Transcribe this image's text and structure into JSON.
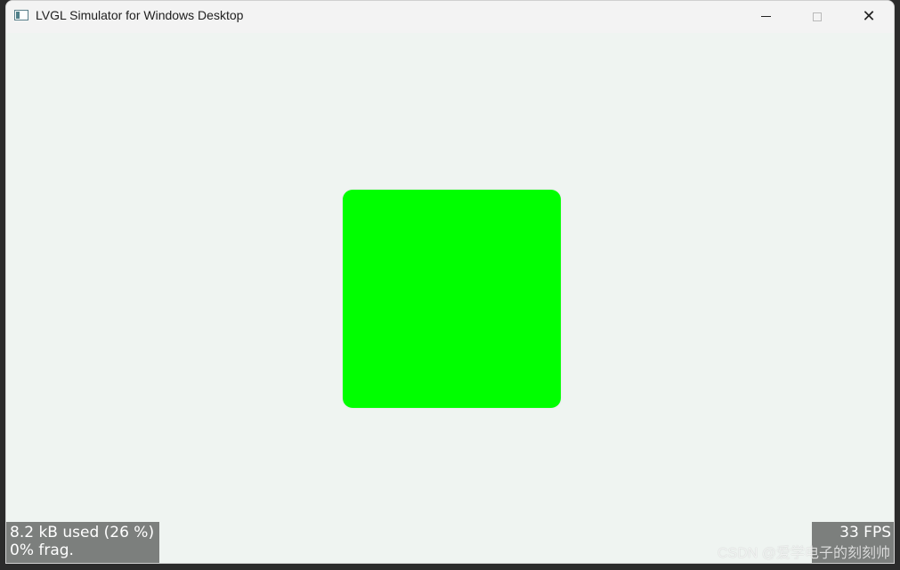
{
  "window": {
    "title": "LVGL Simulator for Windows Desktop",
    "controls": {
      "minimize_icon": "minimize-icon",
      "maximize_icon": "maximize-icon",
      "close_icon": "close-icon",
      "close_glyph": "✕"
    }
  },
  "canvas": {
    "background_color": "#eff4f1",
    "object": {
      "color": "#00ff00"
    }
  },
  "status": {
    "memory_used": "8.2 kB used (26 %)",
    "fragmentation": "0% frag.",
    "fps": "33 FPS"
  },
  "watermark": {
    "text": "CSDN @爱学电子的刻刻帅"
  }
}
